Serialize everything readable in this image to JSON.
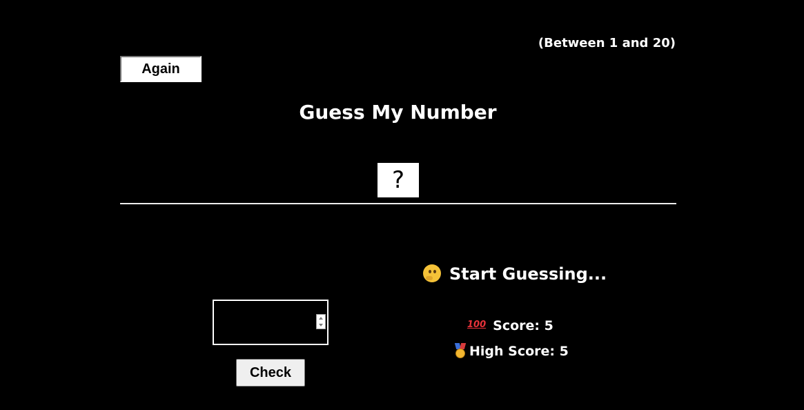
{
  "header": {
    "range_hint": "(Between 1 and 20)",
    "again_label": "Again",
    "title": "Guess My Number",
    "secret_display": "?"
  },
  "left": {
    "guess_value": "",
    "check_label": "Check"
  },
  "right": {
    "message": "Start Guessing...",
    "score_label": "Score: 5",
    "highscore_label": "High Score: 5",
    "hundred_icon_text": "100"
  },
  "colors": {
    "background": "#000000",
    "text": "#ffffff",
    "number_box": "#ffffff"
  },
  "icons": {
    "message_icon": "thinking-face-icon",
    "score_icon": "hundred-points-icon",
    "highscore_icon": "medal-icon"
  }
}
